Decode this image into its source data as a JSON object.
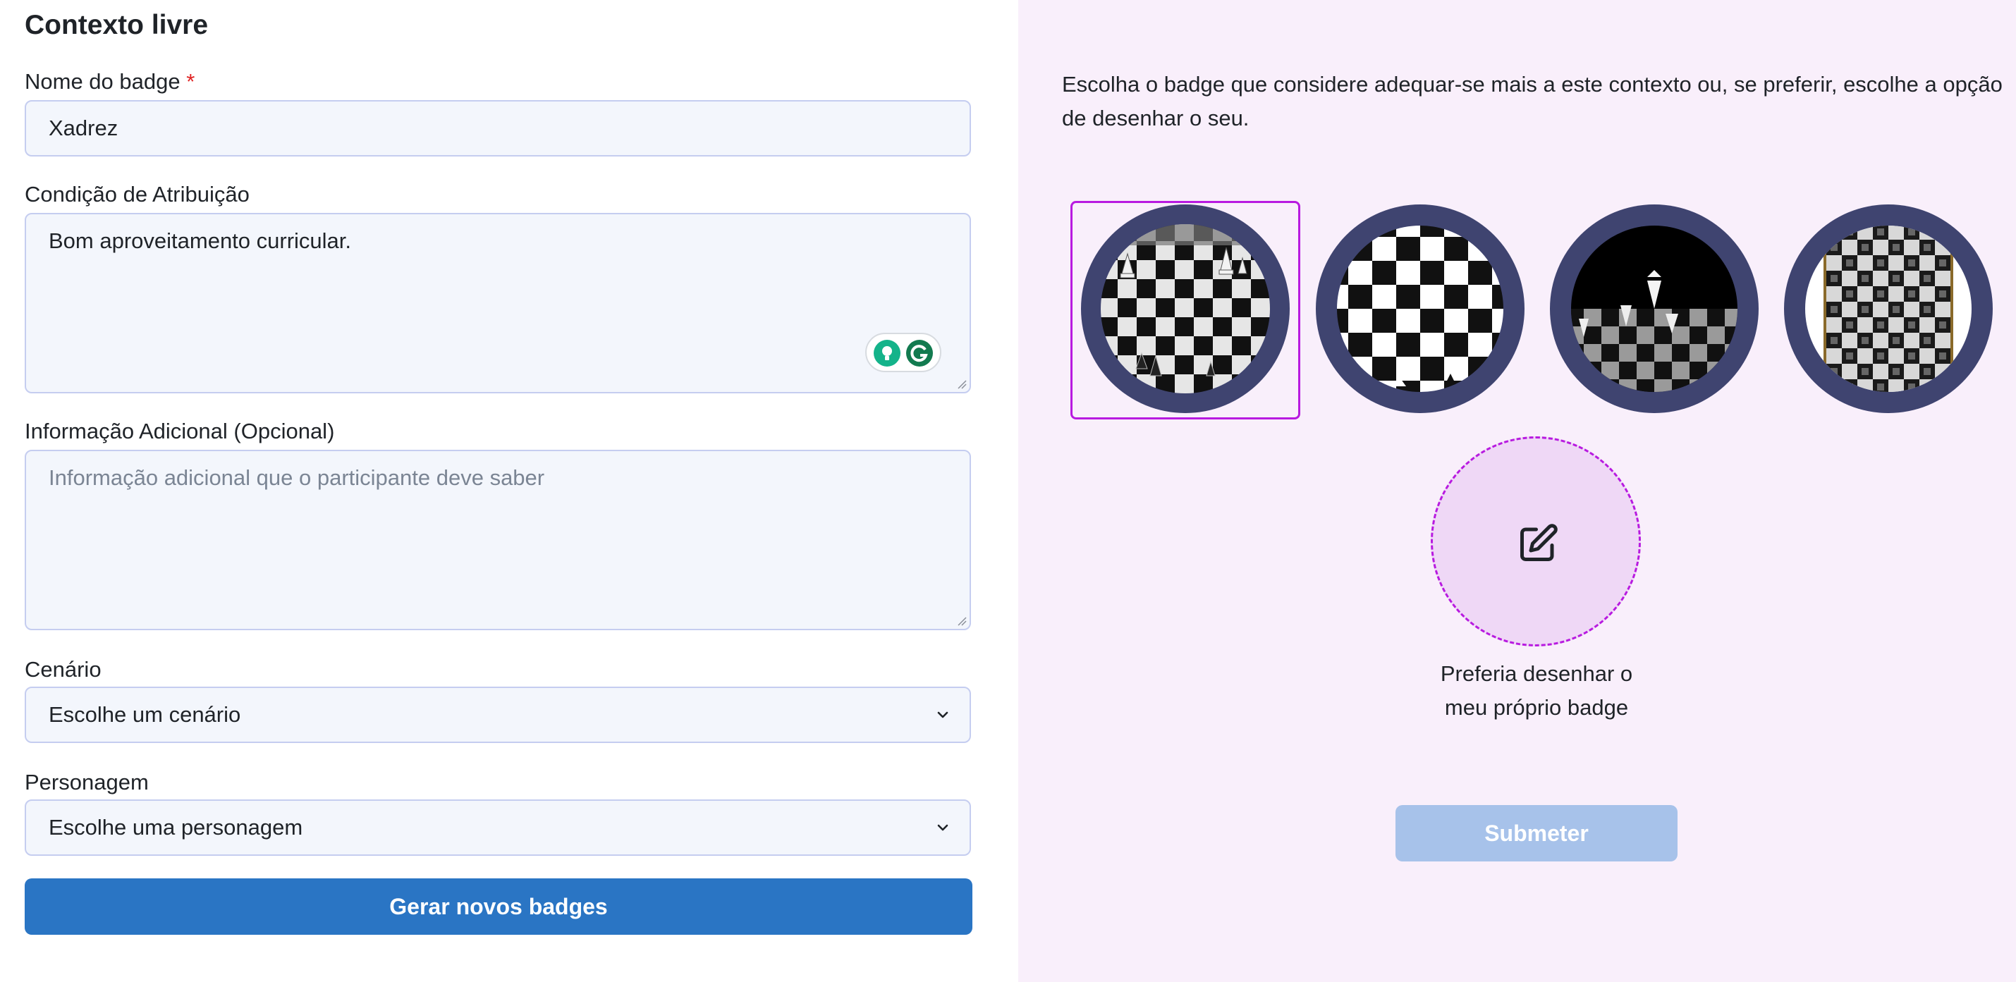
{
  "form": {
    "title": "Contexto livre",
    "badge_name_label": "Nome do badge",
    "required_mark": "*",
    "badge_name_value": "Xadrez",
    "condition_label": "Condição de Atribuição",
    "condition_value": "Bom aproveitamento curricular.",
    "additional_label": "Informação Adicional (Opcional)",
    "additional_placeholder": "Informação adicional que o participante deve saber",
    "scenario_label": "Cenário",
    "scenario_value": "Escolhe um cenário",
    "character_label": "Personagem",
    "character_value": "Escolhe uma personagem",
    "generate_button": "Gerar novos badges"
  },
  "picker": {
    "description": "Escolha o badge que considere adequar-se mais a este contexto ou, se preferir, escolhe a opção de desenhar o seu.",
    "badges": [
      {
        "name": "chess-badge-1",
        "selected": true
      },
      {
        "name": "chess-badge-2",
        "selected": false
      },
      {
        "name": "chess-badge-3",
        "selected": false
      },
      {
        "name": "chess-badge-4",
        "selected": false
      }
    ],
    "custom_label": "Preferia desenhar o meu próprio badge",
    "submit_button": "Submeter"
  },
  "colors": {
    "accent": "#b81ae0",
    "primary": "#2a75c4",
    "badge_ring": "#3f4470",
    "disabled": "#a7c2ea"
  },
  "grammarly": {
    "icon_1": "lightbulb-icon",
    "icon_2": "grammarly-icon"
  }
}
